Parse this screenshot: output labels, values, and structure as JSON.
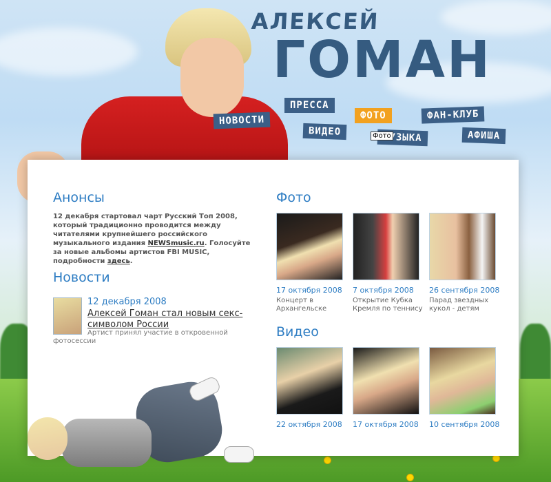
{
  "header": {
    "first_name": "АЛЕКСЕЙ",
    "last_name": "ГОМАН"
  },
  "nav": {
    "items": [
      {
        "label": "НОВОСТИ"
      },
      {
        "label": "ПРЕССА"
      },
      {
        "label": "ВИДЕО"
      },
      {
        "label": "ФОТО"
      },
      {
        "label": "МУЗЫКА"
      },
      {
        "label": "ФАН-КЛУБ"
      },
      {
        "label": "АФИША"
      }
    ],
    "active_index": 3,
    "hover_tag": "Фото"
  },
  "colors": {
    "nav_bg": "#3b5f87",
    "nav_active": "#f2a11f",
    "heading": "#2e7dc3",
    "title": "#355b80"
  },
  "announcements": {
    "title": "Анонсы",
    "text_before": "12 декабря стартовал чарт Русский Топ 2008, который традиционно проводится между читателями крупнейшего российского музыкального издания ",
    "link1": "NEWSmusic.ru",
    "text_middle": ". Голосуйте за новые альбомы артистов FBI MUSIC, подробности ",
    "link2": "здесь",
    "text_after": "."
  },
  "news": {
    "title": "Новости",
    "item": {
      "date": "12 декабря 2008",
      "headline": "Алексей Гоман стал новым секс-символом России",
      "description": "Артист принял участие в откровенной фотосессии"
    }
  },
  "photos": {
    "title": "Фото",
    "items": [
      {
        "date": "17 октября 2008",
        "caption": "Концерт в Архангельске"
      },
      {
        "date": "7 октября 2008",
        "caption": "Открытие Кубка Кремля по теннису"
      },
      {
        "date": "26 сентября 2008",
        "caption": "Парад звездных кукол - детям"
      }
    ]
  },
  "videos": {
    "title": "Видео",
    "items": [
      {
        "date": "22 октября 2008"
      },
      {
        "date": "17 октября 2008"
      },
      {
        "date": "10 сентября 2008"
      }
    ]
  }
}
